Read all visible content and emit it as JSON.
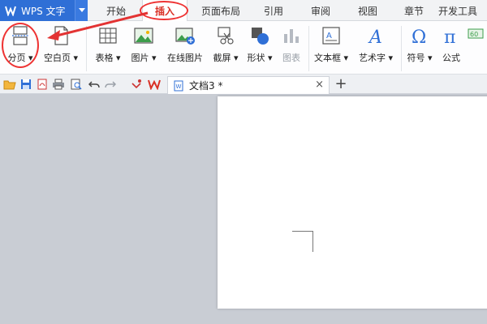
{
  "app": {
    "title": "WPS 文字"
  },
  "menu": {
    "tabs": [
      {
        "label": "开始"
      },
      {
        "label": "插入"
      },
      {
        "label": "页面布局"
      },
      {
        "label": "引用"
      },
      {
        "label": "审阅"
      },
      {
        "label": "视图"
      },
      {
        "label": "章节"
      },
      {
        "label": "开发工具"
      }
    ],
    "active_tab": "插入"
  },
  "ribbon": {
    "tools": [
      {
        "label": "分页 ▾"
      },
      {
        "label": "空白页 ▾"
      },
      {
        "label": "表格 ▾"
      },
      {
        "label": "图片 ▾"
      },
      {
        "label": "在线图片"
      },
      {
        "label": "截屏 ▾"
      },
      {
        "label": "形状 ▾"
      },
      {
        "label": "图表"
      },
      {
        "label": "文本框 ▾"
      },
      {
        "label": "艺术字 ▾"
      },
      {
        "label": "符号 ▾"
      },
      {
        "label": "公式"
      }
    ]
  },
  "document_tab": {
    "name": "文档3 *"
  },
  "colors": {
    "brand": "#2f6fd6",
    "annotation": "#e33333",
    "active_tab_text": "#d93025"
  }
}
